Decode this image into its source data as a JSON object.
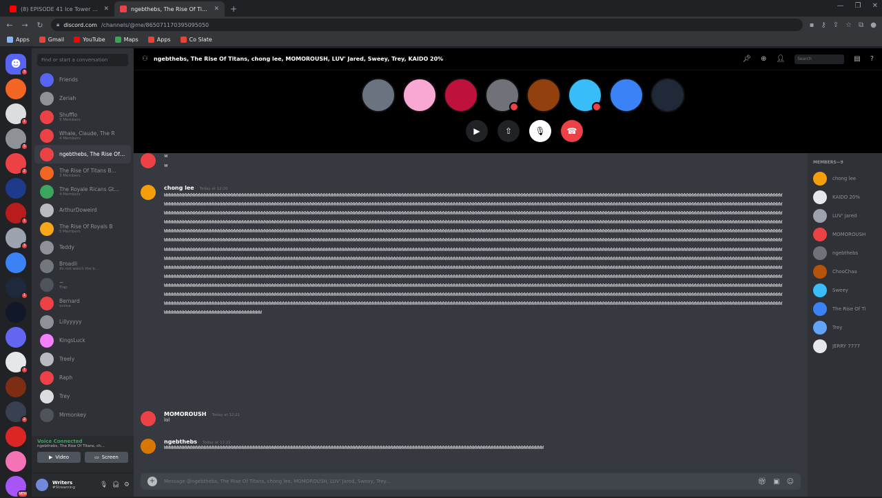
{
  "browser": {
    "tabs": [
      {
        "title": "(8) EPISODE 41 Ice Tower Defe",
        "favicon_color": "#ff0000",
        "active": false
      },
      {
        "title": "ngebthebs, The Rise Of Ti...",
        "favicon_color": "#ed4245",
        "active": true
      }
    ],
    "new_tab": "+",
    "window_controls": {
      "minimize": "—",
      "restore": "❐",
      "close": "✕"
    },
    "url": {
      "domain": "discord.com",
      "path": "/channels/@me/865071170395095050"
    },
    "bookmarks": [
      {
        "label": "Apps",
        "color": "#8ab4f8"
      },
      {
        "label": "Gmail",
        "color": "#ea4335"
      },
      {
        "label": "YouTube",
        "color": "#ff0000"
      },
      {
        "label": "Maps",
        "color": "#34a853"
      },
      {
        "label": "Apps",
        "color": "#ea4335"
      },
      {
        "label": "Co Slate",
        "color": "#ea4335"
      }
    ]
  },
  "dm_list": {
    "search_placeholder": "Find or start a conversation",
    "items": [
      {
        "name": "Friends",
        "sub": "",
        "color": "#5865f2",
        "active": false
      },
      {
        "name": "Zeriah",
        "sub": "",
        "color": "#8e9297",
        "active": false
      },
      {
        "name": "Shufflo",
        "sub": "5 Members",
        "color": "#ed4245",
        "active": false
      },
      {
        "name": "Whale, Claude, The R",
        "sub": "4 Members",
        "color": "#ed4245",
        "active": false
      },
      {
        "name": "ngebthebs, The Rise Of Ti",
        "sub": "",
        "color": "#ed4245",
        "active": true
      },
      {
        "name": "The Rise Of Titans B...",
        "sub": "3 Members",
        "color": "#f26522",
        "active": false
      },
      {
        "name": "The Royale Ricans Gt...",
        "sub": "4 Members",
        "color": "#3ba55d",
        "active": false
      },
      {
        "name": "ArthurDoweird",
        "sub": "",
        "color": "#b9bbbe",
        "active": false
      },
      {
        "name": "The Rise Of Royals B",
        "sub": "5 Members",
        "color": "#faa61a",
        "active": false
      },
      {
        "name": "Teddy",
        "sub": "",
        "color": "#8e9297",
        "active": false
      },
      {
        "name": "Broadli",
        "sub": "do not watch the b...",
        "color": "#72767d",
        "active": false
      },
      {
        "name": "~",
        "sub": "Trap",
        "color": "#4f545c",
        "active": false
      },
      {
        "name": "Bernard",
        "sub": "online",
        "color": "#ed4245",
        "active": false
      },
      {
        "name": "Lillyyyyy",
        "sub": "",
        "color": "#8e9297",
        "active": false
      },
      {
        "name": "KingsLuck",
        "sub": "",
        "color": "#f47fff",
        "active": false
      },
      {
        "name": "Treely",
        "sub": "",
        "color": "#b9bbbe",
        "active": false
      },
      {
        "name": "Raph",
        "sub": "",
        "color": "#ed4245",
        "active": false
      },
      {
        "name": "Trey",
        "sub": "",
        "color": "#dcddde",
        "active": false
      },
      {
        "name": "Mrmonkey",
        "sub": "",
        "color": "#4f545c",
        "active": false
      }
    ]
  },
  "voice": {
    "status": "Voice Connected",
    "channel": "ngebthebs, The Rise Of Titans, ch...",
    "video_label": "Video",
    "screen_label": "Screen"
  },
  "user": {
    "name": "Writers",
    "tag": "#Streaming",
    "color": "#7289da"
  },
  "servers": [
    {
      "color": "#5865f2",
      "badge": "3",
      "home": true
    },
    {
      "color": "#f26522",
      "badge": ""
    },
    {
      "color": "#dcddde",
      "badge": "1"
    },
    {
      "color": "#8e9297",
      "badge": "5"
    },
    {
      "color": "#ed4245",
      "badge": "2"
    },
    {
      "color": "#1e3a8a",
      "badge": ""
    },
    {
      "color": "#b91c1c",
      "badge": "1"
    },
    {
      "color": "#9ca3af",
      "badge": "3"
    },
    {
      "color": "#3b82f6",
      "badge": ""
    },
    {
      "color": "#1e293b",
      "badge": "1"
    },
    {
      "color": "#111827",
      "badge": ""
    },
    {
      "color": "#6366f1",
      "badge": ""
    },
    {
      "color": "#e5e7eb",
      "badge": "1"
    },
    {
      "color": "#7c2d12",
      "badge": ""
    },
    {
      "color": "#374151",
      "badge": "2"
    },
    {
      "color": "#dc2626",
      "badge": ""
    },
    {
      "color": "#f472b6",
      "badge": ""
    },
    {
      "color": "#a855f7",
      "badge": "NEW"
    }
  ],
  "header": {
    "title": "ngebthebs, The Rise Of Titans, chong lee, MOMOROUSH, LUV' Jared, Sweey, Trey, KAIDO 20%",
    "search_placeholder": "Search"
  },
  "call": {
    "participant_colors": [
      "#6b7280",
      "#f9a8d4",
      "#be123c",
      "#71717a",
      "#92400e",
      "#38bdf8",
      "#3b82f6",
      "#1f2937"
    ],
    "muted": [
      false,
      false,
      false,
      true,
      false,
      true,
      false,
      false
    ]
  },
  "messages": [
    {
      "author": "",
      "time": "",
      "lines": [
        "w",
        "w"
      ],
      "color": "#ed4245"
    },
    {
      "author": "chong lee",
      "time": "Today at 12:20",
      "color": "#f59e0b"
    },
    {
      "author": "MOMOROUSH",
      "time": "Today at 12:21",
      "text": "lol",
      "color": "#ed4245"
    },
    {
      "author": "ngebthebs",
      "time": "Today at 12:21",
      "color": "#d97706"
    }
  ],
  "composer": {
    "placeholder": "Message @ngebthebs, The Rise Of Titans, chong lee, MOMOROUSH, LUV' Jared, Sweey, Trey..."
  },
  "members": {
    "header": "MEMBERS—9",
    "items": [
      {
        "name": "chong lee",
        "color": "#f59e0b"
      },
      {
        "name": "KAIDO 20%",
        "color": "#e5e7eb"
      },
      {
        "name": "LUV' Jared",
        "color": "#9ca3af"
      },
      {
        "name": "MOMOROUSH",
        "color": "#ed4245"
      },
      {
        "name": "ngebthebs",
        "color": "#71717a"
      },
      {
        "name": "ChooChaa",
        "color": "#b45309"
      },
      {
        "name": "Sweey",
        "color": "#38bdf8"
      },
      {
        "name": "The Rise Of Ti",
        "color": "#3b82f6"
      },
      {
        "name": "Trey",
        "color": "#60a5fa"
      },
      {
        "name": "JERRY 7777",
        "color": "#e5e7eb"
      }
    ]
  }
}
